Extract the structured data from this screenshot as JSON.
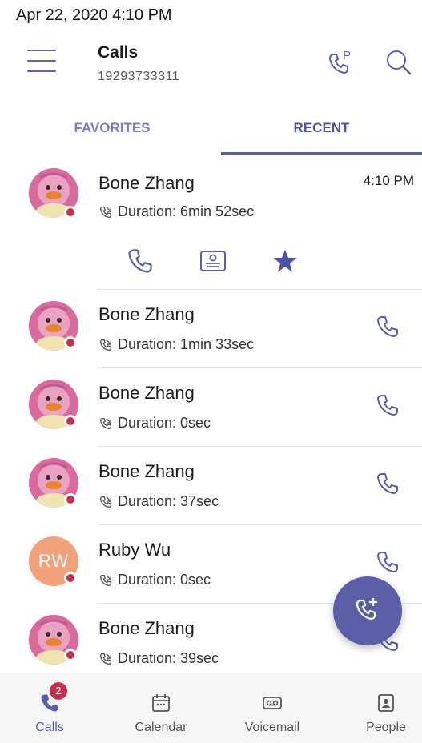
{
  "status_bar": {
    "datetime": "Apr 22, 2020  4:10 PM"
  },
  "header": {
    "title": "Calls",
    "subtitle": "19293733311"
  },
  "tabs": [
    {
      "label": "FAVORITES",
      "active": false
    },
    {
      "label": "RECENT",
      "active": true
    }
  ],
  "calls": [
    {
      "name": "Bone Zhang",
      "duration": "Duration: 6min 52sec",
      "time": "4:10 PM",
      "avatar": "photo",
      "expanded": true
    },
    {
      "name": "Bone Zhang",
      "duration": "Duration: 1min 33sec",
      "avatar": "photo"
    },
    {
      "name": "Bone Zhang",
      "duration": "Duration: 0sec",
      "avatar": "photo"
    },
    {
      "name": "Bone Zhang",
      "duration": "Duration: 37sec",
      "avatar": "photo"
    },
    {
      "name": "Ruby Wu",
      "duration": "Duration: 0sec",
      "avatar": "initials",
      "initials": "RW"
    },
    {
      "name": "Bone Zhang",
      "duration": "Duration: 39sec",
      "avatar": "photo"
    }
  ],
  "bottom_nav": [
    {
      "label": "Calls",
      "icon": "phone-icon",
      "badge": "2",
      "active": true
    },
    {
      "label": "Calendar",
      "icon": "calendar-icon"
    },
    {
      "label": "Voicemail",
      "icon": "voicemail-icon"
    },
    {
      "label": "People",
      "icon": "contact-card-icon"
    }
  ],
  "colors": {
    "accent": "#5b5fa8",
    "presence_busy": "#c4314b",
    "avatar_initials_bg": "#f2a27b"
  }
}
